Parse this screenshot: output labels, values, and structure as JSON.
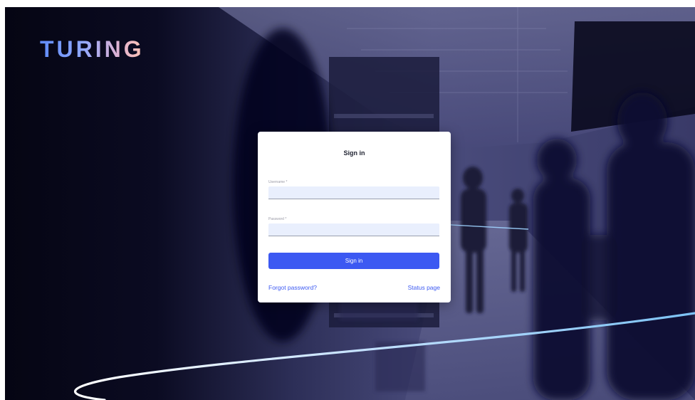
{
  "brand": {
    "logo_text": "TURING"
  },
  "login_card": {
    "title": "Sign in",
    "username_label": "Username *",
    "username_value": "",
    "password_label": "Password *",
    "password_value": "",
    "submit_label": "Sign in",
    "forgot_password_link": "Forgot password?",
    "status_page_link": "Status page"
  },
  "colors": {
    "primary": "#3c59f2",
    "background_dark": "#050513",
    "photo_tint": "#3b3d6b",
    "input_background": "#e9effd",
    "card_background": "#ffffff",
    "accent_line": "#8ccaf5"
  },
  "icons": {
    "background": "supermarket-shoppers-photo"
  }
}
